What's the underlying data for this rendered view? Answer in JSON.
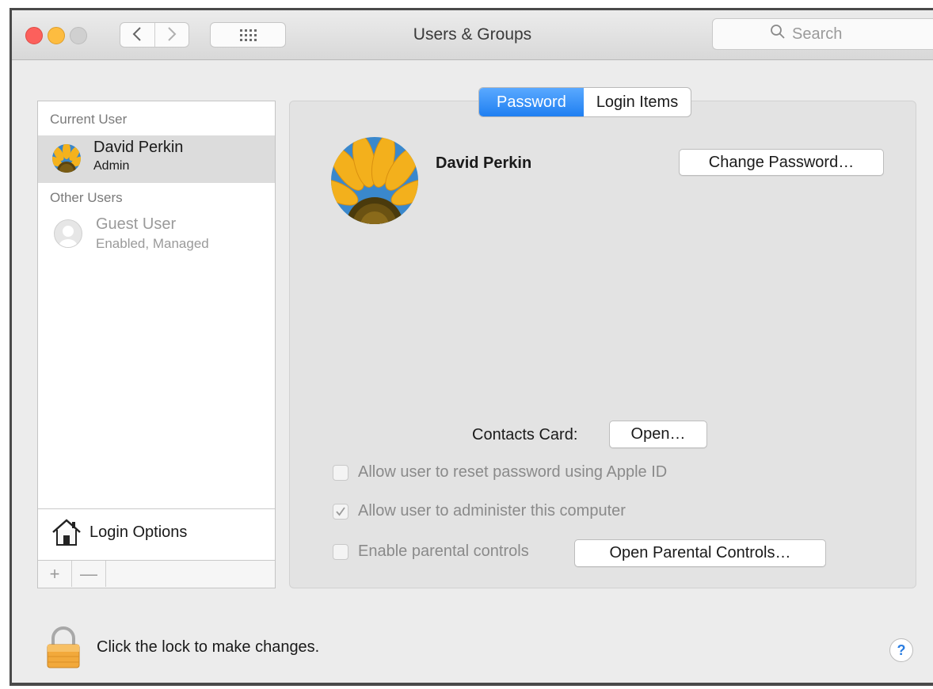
{
  "window": {
    "title": "Users & Groups",
    "search_placeholder": "Search"
  },
  "sidebar": {
    "current_user_label": "Current User",
    "current_user": {
      "name": "David Perkin",
      "role": "Admin"
    },
    "other_users_label": "Other Users",
    "other_users": [
      {
        "name": "Guest User",
        "status": "Enabled, Managed"
      }
    ],
    "login_options_label": "Login Options",
    "add_label": "+",
    "remove_label": "—"
  },
  "tabs": [
    {
      "label": "Password",
      "active": true
    },
    {
      "label": "Login Items",
      "active": false
    }
  ],
  "main": {
    "user_name": "David Perkin",
    "change_password_label": "Change Password…",
    "contacts_card_label": "Contacts Card:",
    "open_label": "Open…",
    "checkboxes": [
      {
        "label": "Allow user to reset password using Apple ID",
        "checked": false
      },
      {
        "label": "Allow user to administer this computer",
        "checked": true
      },
      {
        "label": "Enable parental controls",
        "checked": false
      }
    ],
    "open_parental_controls_label": "Open Parental Controls…"
  },
  "footer": {
    "lock_text": "Click the lock to make changes.",
    "help_label": "?"
  },
  "colors": {
    "accent": "#1f7ff1",
    "close": "#fc605c",
    "minimize": "#fdbc40"
  },
  "icons": [
    "chevron-left-icon",
    "chevron-right-icon",
    "grid-icon",
    "search-icon",
    "house-icon",
    "lock-icon",
    "help-icon"
  ]
}
